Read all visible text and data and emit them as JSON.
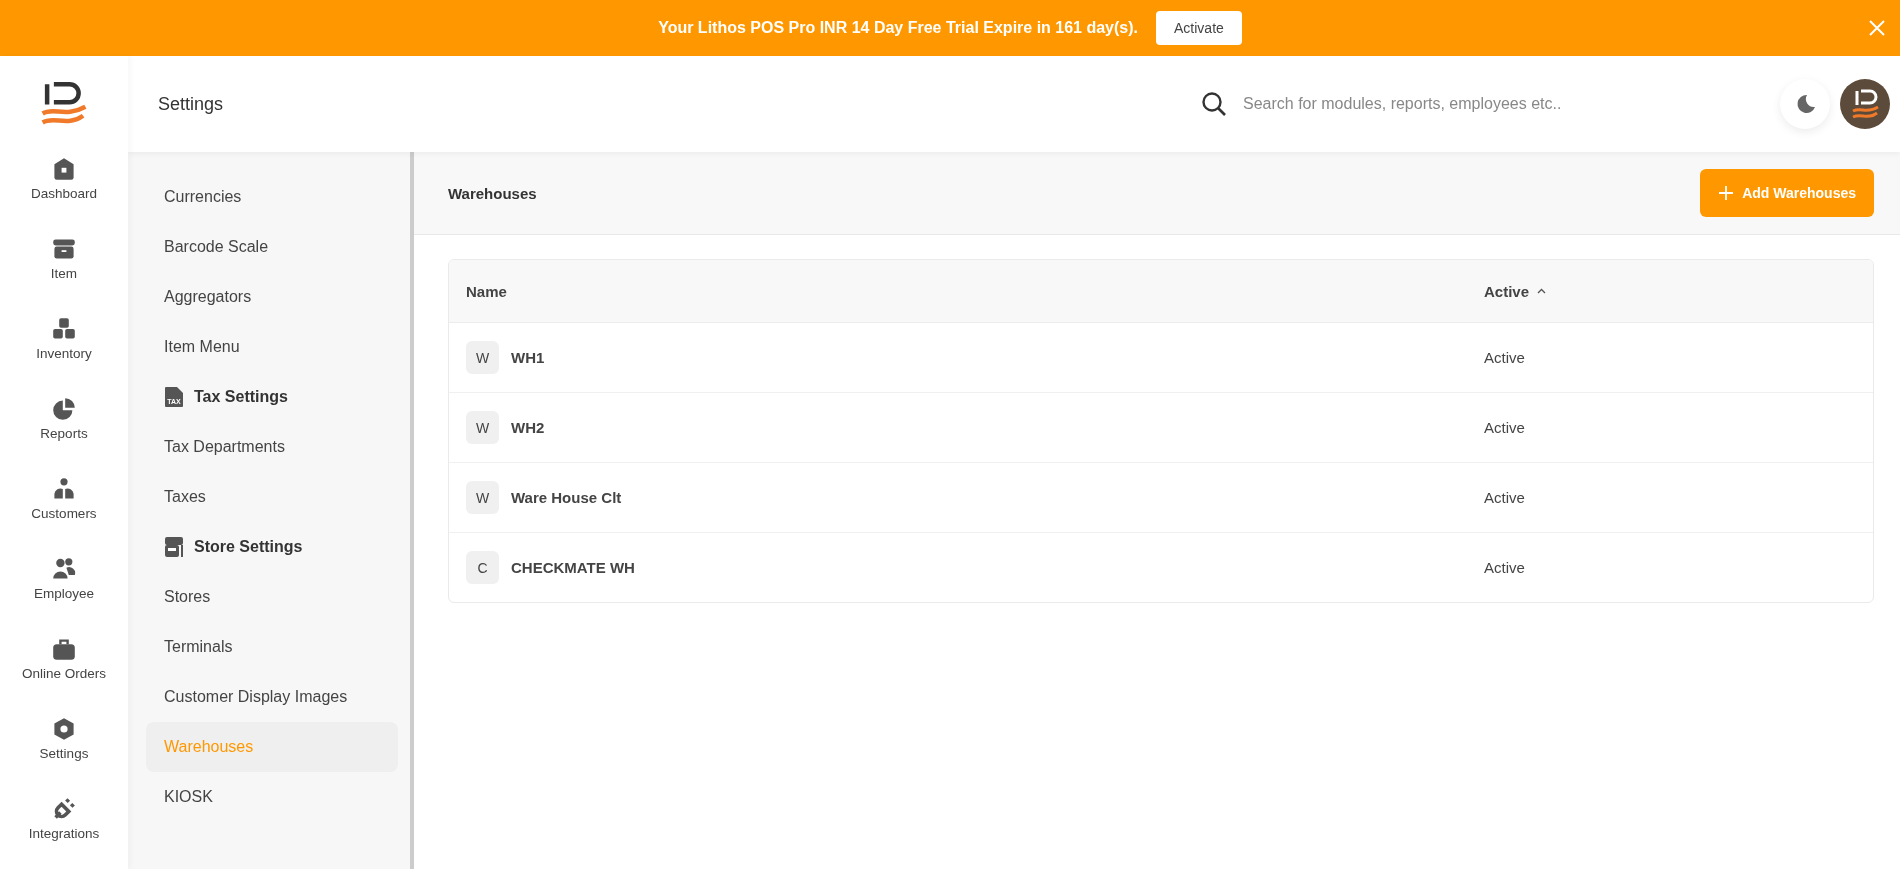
{
  "banner": {
    "message": "Your Lithos POS Pro INR 14 Day Free Trial Expire in 161 day(s).",
    "button": "Activate"
  },
  "header": {
    "title": "Settings",
    "search": {
      "placeholder": "Search for modules, reports, employees etc.."
    }
  },
  "nav": [
    {
      "label": "Dashboard"
    },
    {
      "label": "Item"
    },
    {
      "label": "Inventory"
    },
    {
      "label": "Reports"
    },
    {
      "label": "Customers"
    },
    {
      "label": "Employee"
    },
    {
      "label": "Online Orders"
    },
    {
      "label": "Settings"
    },
    {
      "label": "Integrations"
    }
  ],
  "settings_menu": [
    {
      "kind": "item",
      "label": "Currencies",
      "selected": false
    },
    {
      "kind": "item",
      "label": "Barcode Scale",
      "selected": false
    },
    {
      "kind": "item",
      "label": "Aggregators",
      "selected": false
    },
    {
      "kind": "item",
      "label": "Item Menu",
      "selected": false
    },
    {
      "kind": "heading",
      "label": "Tax Settings",
      "icon_text": "TAX"
    },
    {
      "kind": "item",
      "label": "Tax Departments",
      "selected": false
    },
    {
      "kind": "item",
      "label": "Taxes",
      "selected": false
    },
    {
      "kind": "heading",
      "label": "Store Settings"
    },
    {
      "kind": "item",
      "label": "Stores",
      "selected": false
    },
    {
      "kind": "item",
      "label": "Terminals",
      "selected": false
    },
    {
      "kind": "item",
      "label": "Customer Display Images",
      "selected": false
    },
    {
      "kind": "item",
      "label": "Warehouses",
      "selected": true
    },
    {
      "kind": "item",
      "label": "KIOSK",
      "selected": false
    }
  ],
  "page": {
    "title": "Warehouses",
    "add_button": "Add Warehouses"
  },
  "table": {
    "columns": [
      "Name",
      "Active"
    ],
    "rows": [
      {
        "initial": "W",
        "name": "WH1",
        "status": "Active"
      },
      {
        "initial": "W",
        "name": "WH2",
        "status": "Active"
      },
      {
        "initial": "W",
        "name": "Ware House Clt",
        "status": "Active"
      },
      {
        "initial": "C",
        "name": "CHECKMATE WH",
        "status": "Active"
      }
    ]
  }
}
